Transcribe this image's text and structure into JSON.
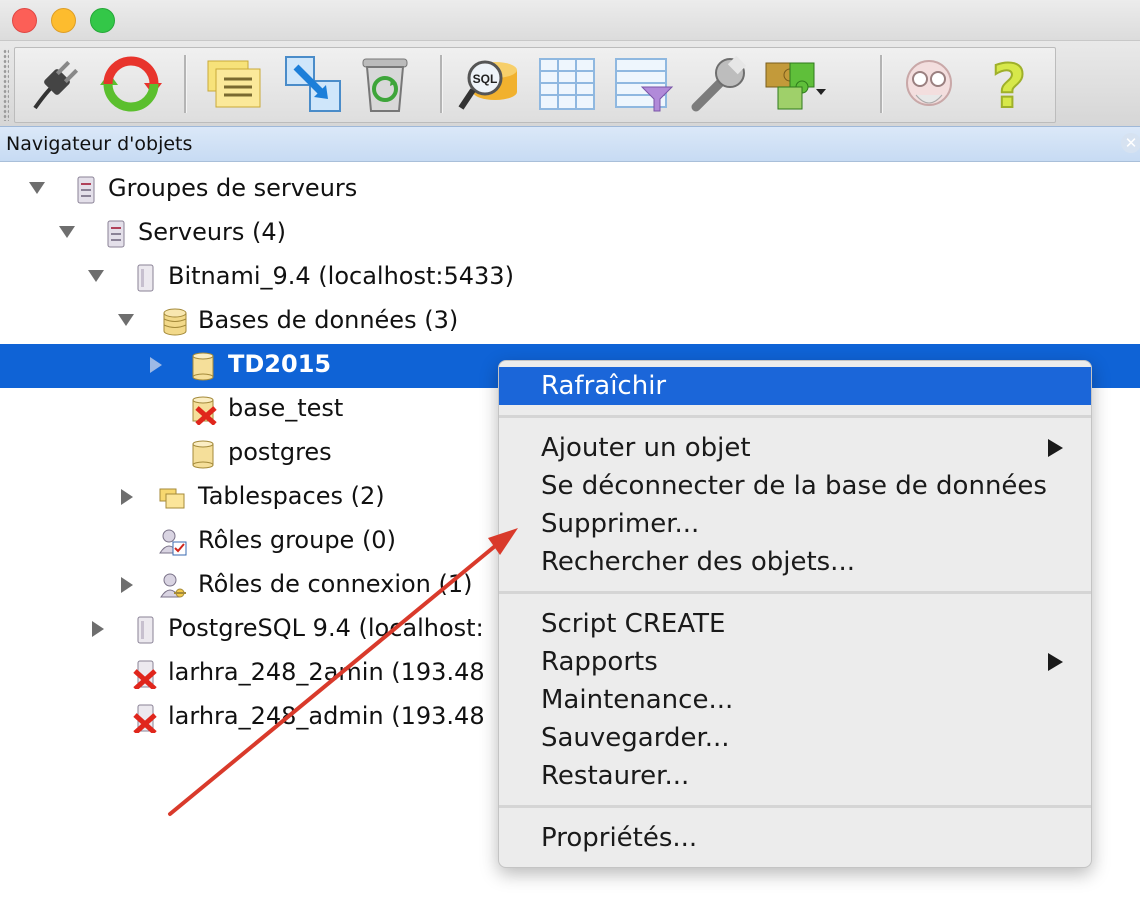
{
  "window": {
    "traffic_lights": [
      "close",
      "minimize",
      "zoom"
    ]
  },
  "toolbar": {
    "buttons": [
      {
        "name": "connect-icon"
      },
      {
        "name": "refresh-icon"
      },
      {
        "name": "properties-icon"
      },
      {
        "name": "create-object-icon"
      },
      {
        "name": "delete-icon"
      },
      {
        "name": "sql-query-icon"
      },
      {
        "name": "view-data-icon"
      },
      {
        "name": "filtered-data-icon"
      },
      {
        "name": "maintenance-icon"
      },
      {
        "name": "plugins-icon"
      },
      {
        "name": "tips-icon"
      },
      {
        "name": "help-icon"
      }
    ],
    "sql_icon_label": "SQL",
    "help_glyph": "?"
  },
  "panel": {
    "title": "Navigateur d'objets",
    "close_glyph": "✕"
  },
  "tree": {
    "items": [
      {
        "label": "Groupes de serveurs",
        "icon": "server-group-icon"
      },
      {
        "label": "Serveurs (4)",
        "icon": "server-group-icon"
      },
      {
        "label": "Bitnami_9.4 (localhost:5433)",
        "icon": "server-icon"
      },
      {
        "label": "Bases de données (3)",
        "icon": "databases-icon"
      },
      {
        "label": "TD2015",
        "icon": "database-icon",
        "selected": true
      },
      {
        "label": "base_test",
        "icon": "database-disconnected-icon"
      },
      {
        "label": "postgres",
        "icon": "database-icon"
      },
      {
        "label": "Tablespaces (2)",
        "icon": "tablespaces-icon"
      },
      {
        "label": "Rôles groupe (0)",
        "icon": "group-roles-icon"
      },
      {
        "label": "Rôles de connexion (1)",
        "icon": "login-roles-icon"
      },
      {
        "label": "PostgreSQL 9.4 (localhost:",
        "icon": "server-icon"
      },
      {
        "label": "larhra_248_2amin (193.48",
        "icon": "server-disconnected-icon"
      },
      {
        "label": "larhra_248_admin (193.48",
        "icon": "server-disconnected-icon"
      }
    ]
  },
  "context_menu": {
    "items": [
      {
        "label": "Rafraîchir",
        "highlighted": true
      },
      {
        "label": "Ajouter un objet",
        "submenu": true
      },
      {
        "label": "Se déconnecter de la base de données"
      },
      {
        "label": "Supprimer..."
      },
      {
        "label": "Rechercher des objets..."
      },
      {
        "label": "Script CREATE"
      },
      {
        "label": "Rapports",
        "submenu": true
      },
      {
        "label": "Maintenance..."
      },
      {
        "label": "Sauvegarder..."
      },
      {
        "label": "Restaurer..."
      },
      {
        "label": "Propriétés..."
      }
    ]
  },
  "colors": {
    "selection": "#0f63d6",
    "menu_highlight": "#1b66d9",
    "annotation_arrow": "#d93a2b"
  }
}
